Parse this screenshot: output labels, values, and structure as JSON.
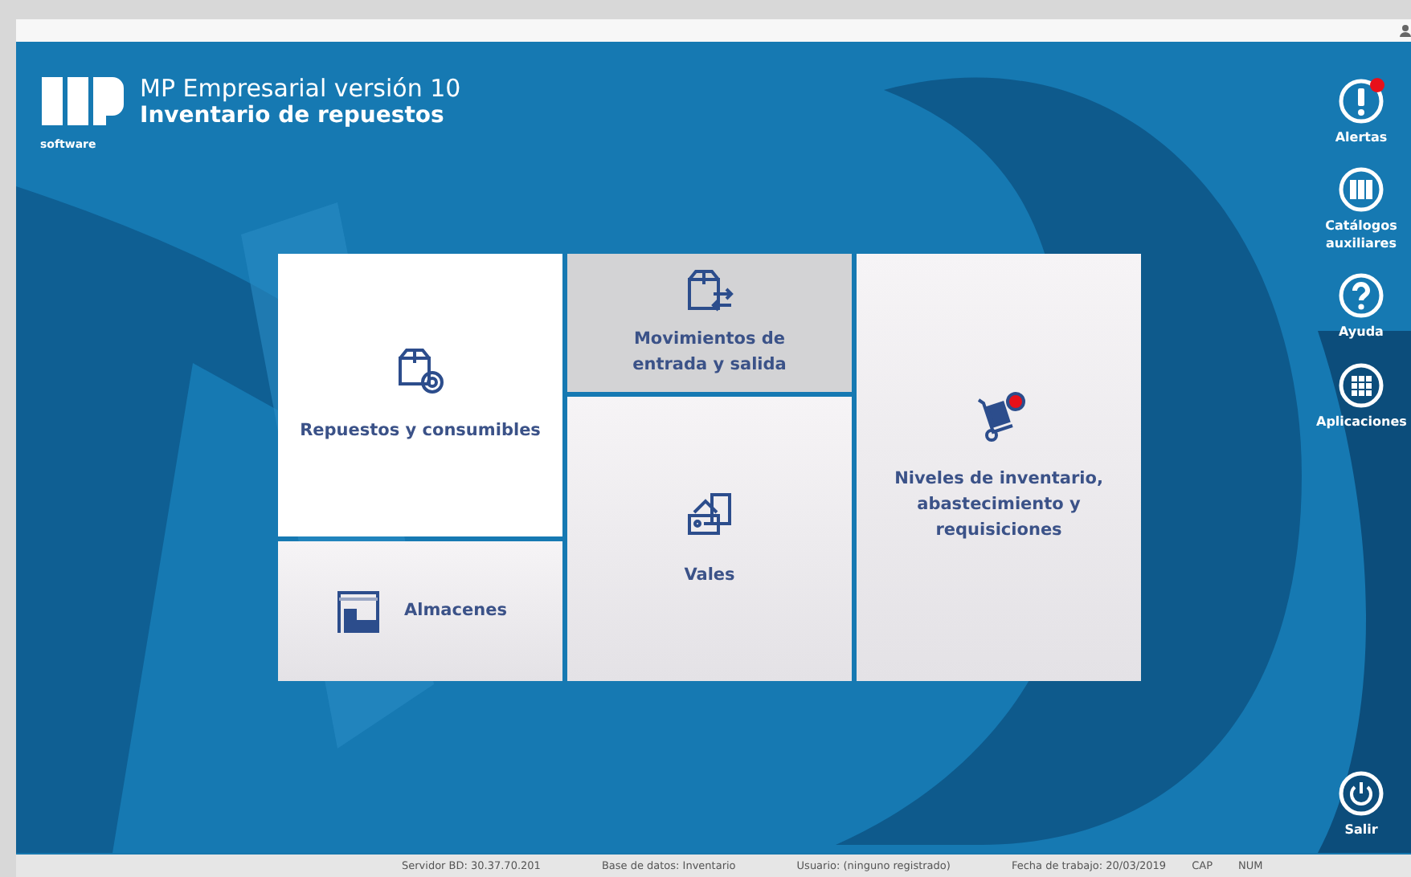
{
  "header": {
    "logo_caption": "software",
    "title": "MP Empresarial versión 10",
    "subtitle": "Inventario de repuestos"
  },
  "tiles": [
    {
      "kind": "parts",
      "label": "Repuestos y consumibles",
      "selected": false,
      "alert": false
    },
    {
      "kind": "movements",
      "label": "Movimientos de entrada y salida",
      "selected": true,
      "alert": false
    },
    {
      "kind": "cart",
      "label": "Niveles de inventario, abastecimiento y requisiciones",
      "selected": false,
      "alert": true
    },
    {
      "kind": "vouchers",
      "label": "Vales",
      "selected": false,
      "alert": false
    },
    {
      "kind": "warehouse",
      "label": "Almacenes",
      "selected": false,
      "alert": false
    }
  ],
  "sidebar": {
    "items": [
      {
        "kind": "alert",
        "label": "Alertas",
        "alert": true
      },
      {
        "kind": "catalog",
        "label": "Catálogos auxiliares",
        "alert": false
      },
      {
        "kind": "help",
        "label": "Ayuda",
        "alert": false
      },
      {
        "kind": "apps",
        "label": "Aplicaciones",
        "alert": false
      }
    ],
    "exit": {
      "label": "Salir"
    }
  },
  "status_bar": [
    "Servidor BD: 30.37.70.201",
    "Base de datos: Inventario",
    "Usuario: (ninguno registrado)",
    "Fecha de trabajo: 20/03/2019",
    "CAP",
    "NUM"
  ]
}
